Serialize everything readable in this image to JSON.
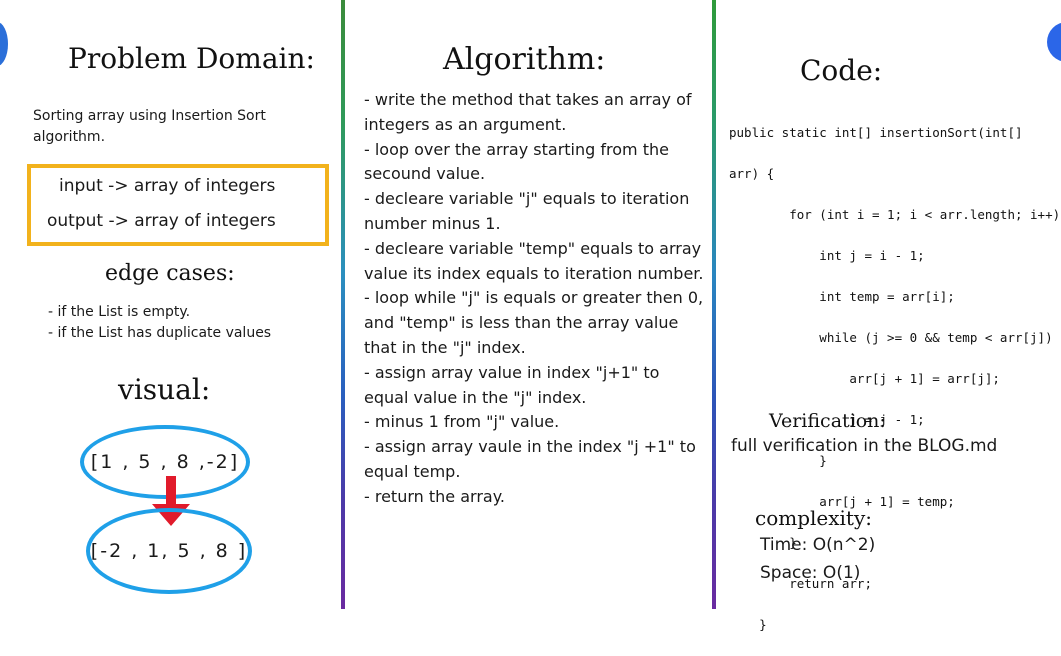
{
  "colors": {
    "io_border": "#f2b21c",
    "circle_border": "#1fa0e8",
    "arrow": "#e11b2b",
    "accent_dot": "#2b66e8"
  },
  "problem_domain": {
    "title": "Problem Domain:",
    "description": "Sorting array using Insertion Sort algorithm.",
    "input_line": "input -> array of integers",
    "output_line": "output -> array of integers"
  },
  "edge_cases": {
    "title": "edge cases:",
    "items": [
      "- if the List is empty.",
      "- if the List has duplicate values"
    ]
  },
  "visual": {
    "title": "visual:",
    "before": "[1 , 5 , 8 ,-2]",
    "after": "[-2 , 1, 5 , 8 ]",
    "arrow_icon": "arrow-down-icon"
  },
  "algorithm": {
    "title": "Algorithm:",
    "steps": [
      "- write the method that takes an array of integers as an argument.",
      "- loop over the array starting from the secound value.",
      "- decleare variable \"j\" equals to iteration number minus 1.",
      "- decleare variable \"temp\" equals to array value its index equals to iteration number.",
      "- loop while \"j\" is equals or greater then 0, and \"temp\" is less than the array value that in the \"j\" index.",
      "- assign array value in index \"j+1\" to equal value in the \"j\" index.",
      "- minus 1 from \"j\" value.",
      "- assign array vaule in the index \"j +1\" to equal temp.",
      "- return the array."
    ]
  },
  "code": {
    "title": "Code:",
    "lines": [
      "public static int[] insertionSort(int[]",
      "arr) {",
      "        for (int i = 1; i < arr.length; i++) {",
      "            int j = i - 1;",
      "            int temp = arr[i];",
      "            while (j >= 0 && temp < arr[j]) {",
      "                arr[j + 1] = arr[j];",
      "                j = j - 1;",
      "            }",
      "            arr[j + 1] = temp;",
      "        }",
      "        return arr;",
      "    }"
    ]
  },
  "verification": {
    "title": "Verification:",
    "text": "full verification in the BLOG.md"
  },
  "complexity": {
    "title": "complexity:",
    "time": "Time: O(n^2)",
    "space": "Space: O(1)"
  }
}
